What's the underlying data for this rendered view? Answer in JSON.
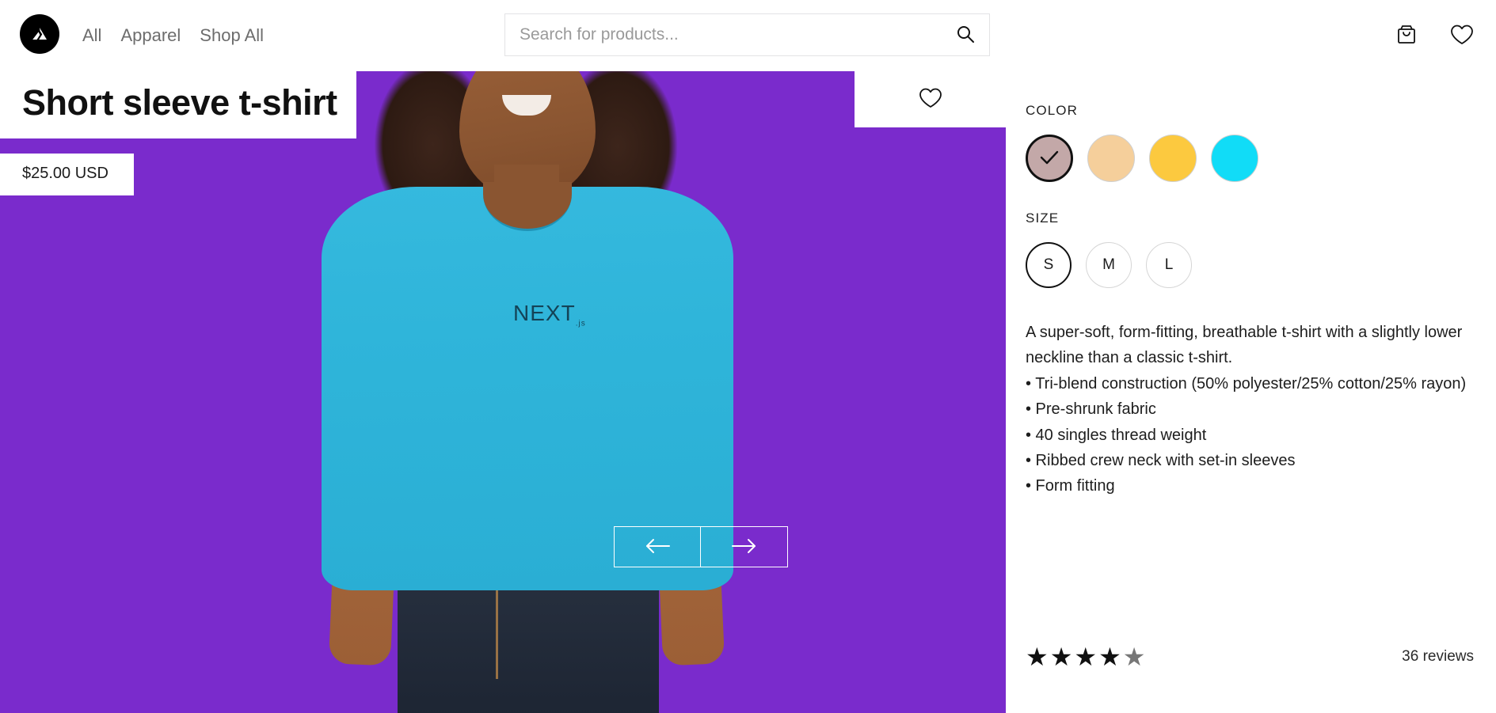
{
  "header": {
    "logo_icon": "brand-triangle-logo",
    "nav": [
      {
        "label": "All"
      },
      {
        "label": "Apparel"
      },
      {
        "label": "Shop All"
      }
    ],
    "search": {
      "placeholder": "Search for products...",
      "value": "",
      "icon": "search-icon"
    },
    "actions": [
      {
        "name": "cart-icon",
        "label": "Cart"
      },
      {
        "name": "wishlist-icon",
        "label": "Wishlist"
      }
    ]
  },
  "product": {
    "title": "Short sleeve t-shirt",
    "price": "$25.00 USD",
    "gallery": {
      "background_color": "#7a2bcc",
      "shirt_color": "#2fb5da",
      "chest_logo": "NEXT",
      "chest_logo_sub": ".js",
      "wishlist_icon": "heart-icon",
      "prev_label": "←",
      "next_label": "→"
    },
    "color": {
      "label": "COLOR",
      "options": [
        {
          "name": "mauve",
          "hex": "#c3a8a8",
          "selected": true
        },
        {
          "name": "peach",
          "hex": "#f5cf9b",
          "selected": false
        },
        {
          "name": "gold",
          "hex": "#fcc93f",
          "selected": false
        },
        {
          "name": "cyan",
          "hex": "#11dcf7",
          "selected": false
        }
      ]
    },
    "size": {
      "label": "SIZE",
      "options": [
        {
          "label": "S",
          "selected": true
        },
        {
          "label": "M",
          "selected": false
        },
        {
          "label": "L",
          "selected": false
        }
      ]
    },
    "description": [
      "A super-soft, form-fitting, breathable t-shirt with a slightly lower neckline than a classic t-shirt.",
      "• Tri-blend construction (50% polyester/25% cotton/25% rayon)",
      "• Pre-shrunk fabric",
      "• 40 singles thread weight",
      "• Ribbed crew neck with set-in sleeves",
      "• Form fitting"
    ],
    "rating": {
      "value": 4,
      "max": 5,
      "filled_glyph": "★",
      "empty_glyph": "★",
      "reviews_text": "36 reviews"
    }
  }
}
